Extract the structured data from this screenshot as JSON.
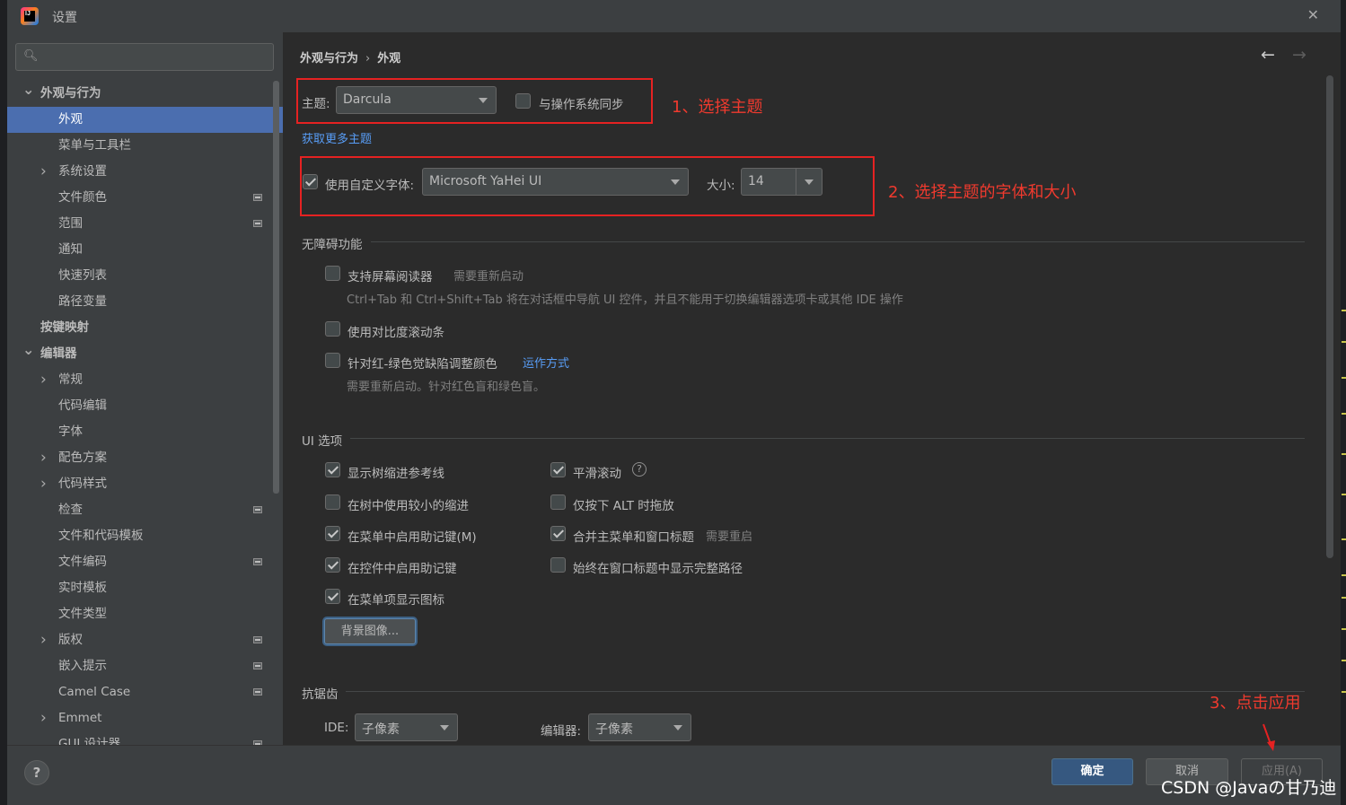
{
  "window": {
    "title": "设置"
  },
  "search": {
    "placeholder": ""
  },
  "sidebar": {
    "items": [
      {
        "label": "外观与行为",
        "arrow": "expanded"
      },
      {
        "label": "外观",
        "selected": true
      },
      {
        "label": "菜单与工具栏"
      },
      {
        "label": "系统设置",
        "arrow": "collapsed"
      },
      {
        "label": "文件颜色",
        "project_icon": true
      },
      {
        "label": "范围",
        "project_icon": true
      },
      {
        "label": "通知"
      },
      {
        "label": "快速列表"
      },
      {
        "label": "路径变量"
      },
      {
        "label": "按键映射",
        "bold": true
      },
      {
        "label": "编辑器",
        "arrow": "expanded"
      },
      {
        "label": "常规",
        "arrow": "collapsed"
      },
      {
        "label": "代码编辑"
      },
      {
        "label": "字体"
      },
      {
        "label": "配色方案",
        "arrow": "collapsed"
      },
      {
        "label": "代码样式",
        "arrow": "collapsed"
      },
      {
        "label": "检查",
        "project_icon": true
      },
      {
        "label": "文件和代码模板"
      },
      {
        "label": "文件编码",
        "project_icon": true
      },
      {
        "label": "实时模板"
      },
      {
        "label": "文件类型"
      },
      {
        "label": "版权",
        "arrow": "collapsed",
        "project_icon": true
      },
      {
        "label": "嵌入提示",
        "project_icon": true
      },
      {
        "label": "Camel Case",
        "project_icon": true
      },
      {
        "label": "Emmet",
        "arrow": "collapsed"
      },
      {
        "label": "GUI 设计器",
        "project_icon": true
      }
    ]
  },
  "breadcrumb": {
    "parent": "外观与行为",
    "separator": "›",
    "current": "外观"
  },
  "nav": {
    "back_icon": "←",
    "forward_icon": "→"
  },
  "theme": {
    "label": "主题:",
    "value": "Darcula",
    "sync_label": "与操作系统同步",
    "sync_checked": false,
    "get_more_link": "获取更多主题"
  },
  "font": {
    "use_custom_label": "使用自定义字体:",
    "use_custom_checked": true,
    "family": "Microsoft YaHei UI",
    "size_label": "大小:",
    "size": "14"
  },
  "accessibility": {
    "title": "无障碍功能",
    "screen_reader_label": "支持屏幕阅读器",
    "screen_reader_checked": false,
    "screen_reader_hint": "需要重新启动",
    "screen_reader_desc": "Ctrl+Tab 和 Ctrl+Shift+Tab 将在对话框中导航 UI 控件，并且不能用于切换编辑器选项卡或其他 IDE 操作",
    "contrast_scrollbars_label": "使用对比度滚动条",
    "contrast_scrollbars_checked": false,
    "color_deficiency_label": "针对红-绿色觉缺陷调整颜色",
    "color_deficiency_checked": false,
    "how_it_works_link": "运作方式",
    "color_deficiency_desc": "需要重新启动。针对红色盲和绿色盲。"
  },
  "ui_options": {
    "title": "UI 选项",
    "left": [
      {
        "label": "显示树缩进参考线",
        "checked": true
      },
      {
        "label": "在树中使用较小的缩进",
        "checked": false
      },
      {
        "label": "在菜单中启用助记键(M)",
        "checked": true
      },
      {
        "label": "在控件中启用助记键",
        "checked": true
      },
      {
        "label": "在菜单项显示图标",
        "checked": true
      }
    ],
    "right": [
      {
        "label": "平滑滚动",
        "checked": true,
        "help": "?"
      },
      {
        "label": "仅按下 ALT 时拖放",
        "checked": false
      },
      {
        "label": "合并主菜单和窗口标题",
        "checked": true,
        "hint": "需要重启"
      },
      {
        "label": "始终在窗口标题中显示完整路径",
        "checked": false
      }
    ],
    "background_button": "背景图像..."
  },
  "antialiasing": {
    "title": "抗锯齿",
    "ide_label": "IDE:",
    "ide_value": "子像素",
    "editor_label": "编辑器:",
    "editor_value": "子像素"
  },
  "footer": {
    "help": "?",
    "ok": "确定",
    "cancel": "取消",
    "apply": "应用(A)"
  },
  "annotations": {
    "step1": "1、选择主题",
    "step2": "2、选择主题的字体和大小",
    "step3": "3、点击应用"
  },
  "watermark": "CSDN @Javaの甘乃迪",
  "colors": {
    "selection": "#4b6eaf",
    "link": "#589df6",
    "annotation_red": "#e52222",
    "ok_button": "#365880"
  }
}
